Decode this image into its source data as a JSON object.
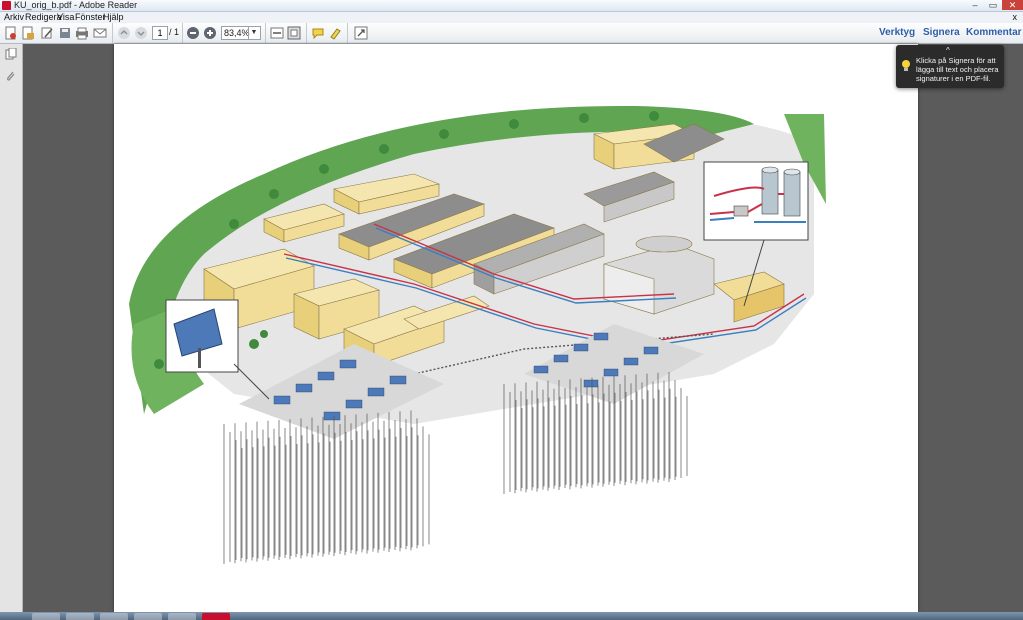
{
  "window": {
    "title": "KU_orig_b.pdf - Adobe Reader",
    "controls": {
      "minimize": "–",
      "maximize": "▭",
      "close": "✕"
    }
  },
  "menu": {
    "items": [
      "Arkiv",
      "Redigera",
      "Visa",
      "Fönster",
      "Hjälp"
    ],
    "close": "x"
  },
  "toolbar": {
    "page_current": "1",
    "page_total": "/ 1",
    "zoom": "83,4%",
    "zoom_dropdown": "▼",
    "links": {
      "tools": "Verktyg",
      "sign": "Signera",
      "comment": "Kommentar"
    }
  },
  "tooltip": {
    "caret": "^",
    "text": "Klicka på Signera för att lägga till text och placera signaturer i en PDF-fil."
  },
  "colors": {
    "accent": "#2f5ea8",
    "doc_background": "#5b5b5b",
    "building": "#f1dc98",
    "roof": "#8d8d8d",
    "forest": "#5fa552",
    "pipe_red": "#c8324a",
    "pipe_blue": "#3a7fc0",
    "borehole": "#555555"
  },
  "icons": {
    "create": "create-pdf-icon",
    "edit": "edit-icon",
    "save": "save-icon",
    "print": "print-icon",
    "email": "email-icon",
    "prev": "arrow-up-icon",
    "next": "arrow-down-icon",
    "zoom_out": "zoom-out-icon",
    "zoom_in": "zoom-in-icon",
    "fit_width": "fit-width-icon",
    "fit_page": "fit-page-icon",
    "comment": "comment-icon",
    "highlight": "highlight-icon",
    "expand": "expand-icon",
    "pages": "pages-panel-icon",
    "attach": "attachment-icon",
    "bulb": "lightbulb-icon"
  }
}
